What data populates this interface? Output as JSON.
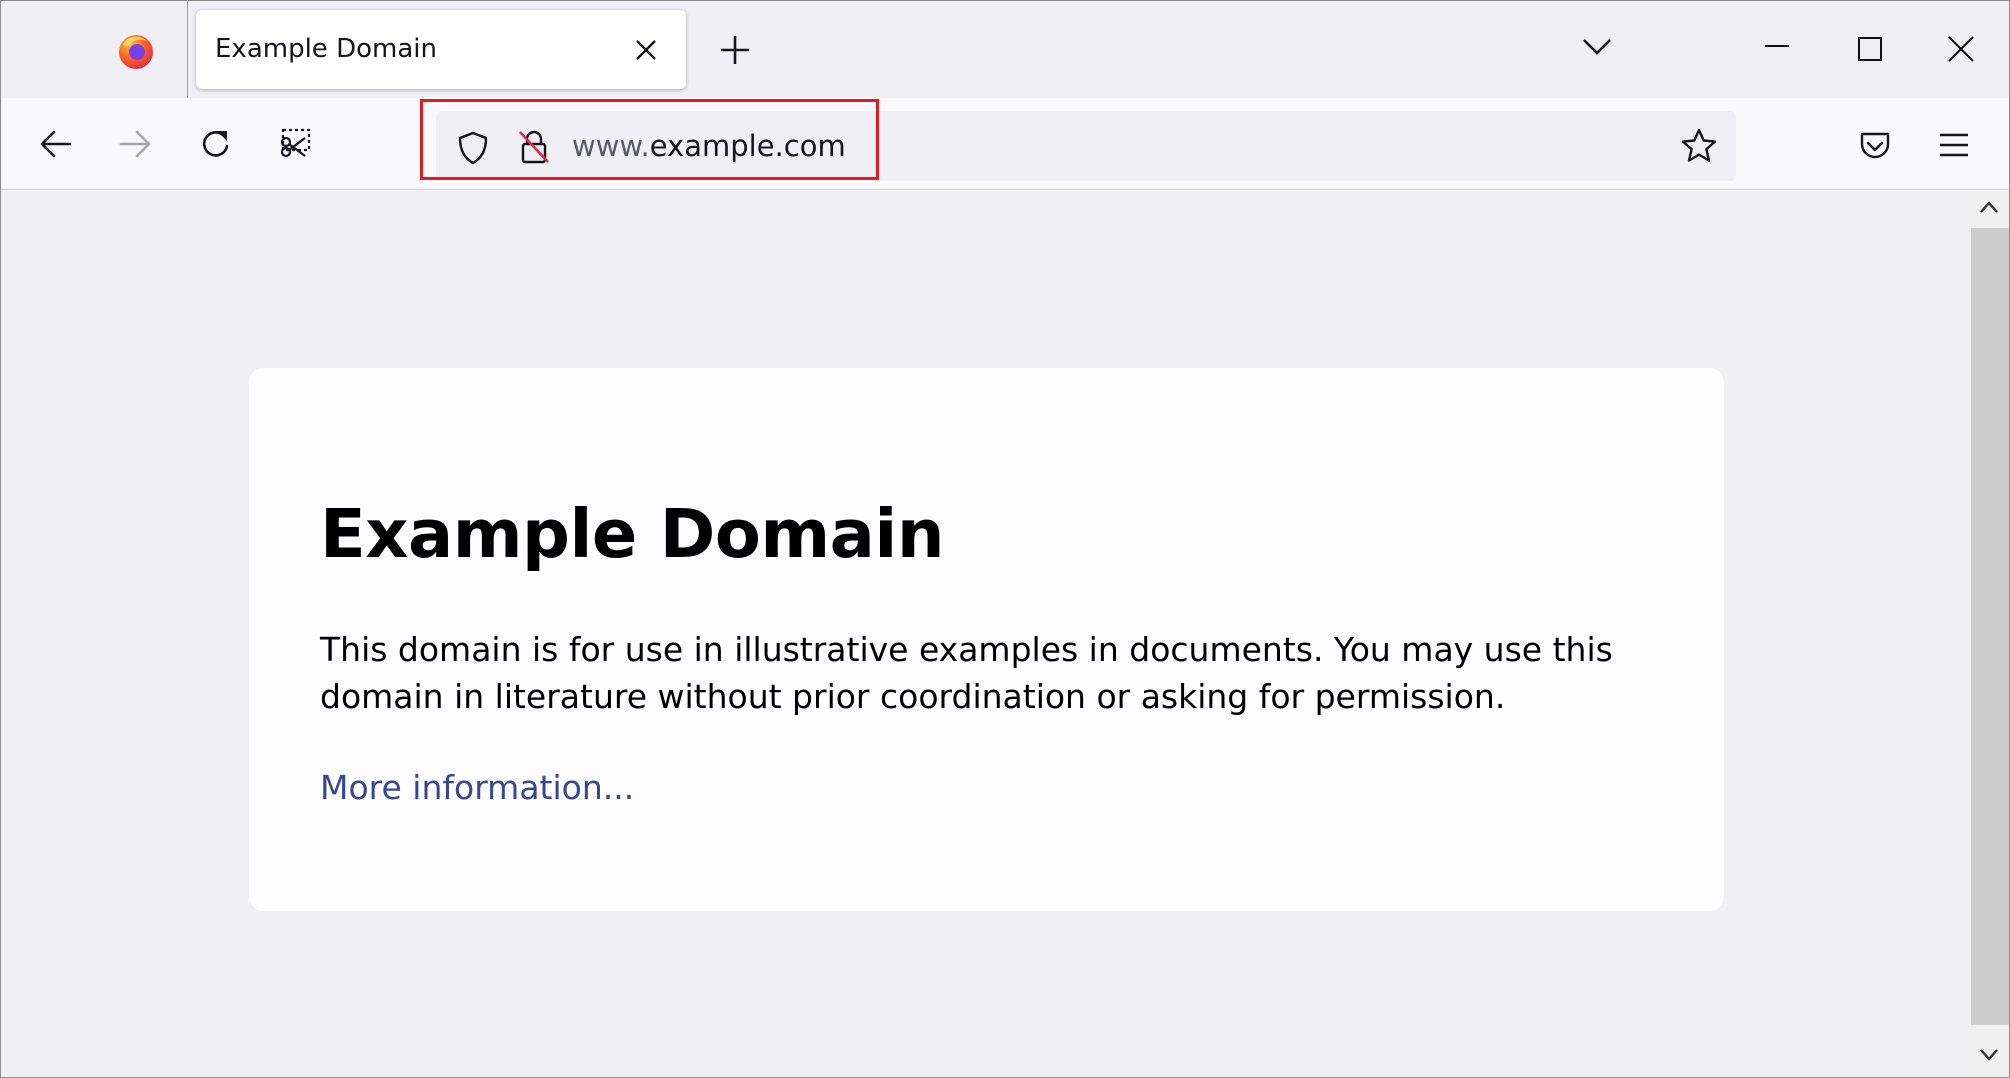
{
  "tab": {
    "title": "Example Domain"
  },
  "urlbar": {
    "url_prefix": "www.",
    "url_domain": "example.com"
  },
  "page": {
    "heading": "Example Domain",
    "paragraph": "This domain is for use in illustrative examples in documents. You may use this domain in literature without prior coordination or asking for permission.",
    "link_text": "More information..."
  },
  "icons": {
    "browser_logo": "firefox-logo",
    "tab_close": "close-icon",
    "new_tab": "plus-icon",
    "tab_list": "chevron-down-icon",
    "window_controls": [
      "minimize-icon",
      "maximize-icon",
      "close-icon"
    ],
    "nav": [
      "back-arrow-icon",
      "forward-arrow-icon",
      "reload-icon",
      "screenshot-icon"
    ],
    "urlbar": [
      "shield-icon",
      "insecure-lock-icon",
      "star-icon"
    ],
    "toolbar_right": [
      "pocket-icon",
      "hamburger-menu-icon"
    ]
  },
  "colors": {
    "highlight_box": "#e01b24",
    "link": "#38488f",
    "chrome_background": "#f0f0f4",
    "page_background": "#f0f0f2",
    "card_background": "#fdfdff"
  }
}
